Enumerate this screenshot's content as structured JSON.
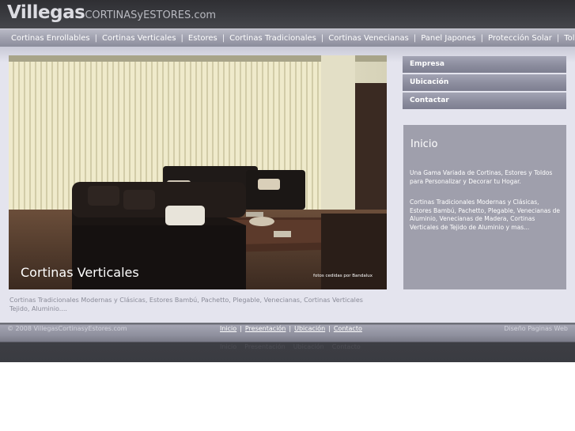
{
  "logo": {
    "main": "Villegas",
    "sub": "CORTINASyESTORES.com"
  },
  "nav": {
    "items": [
      {
        "label": "Cortinas Enrollables"
      },
      {
        "label": "Cortinas Verticales"
      },
      {
        "label": "Estores"
      },
      {
        "label": "Cortinas Tradicionales"
      },
      {
        "label": "Cortinas Venecianas"
      },
      {
        "label": "Panel Japones"
      },
      {
        "label": "Protección Solar"
      },
      {
        "label": "Toldos"
      }
    ],
    "separator": "|"
  },
  "hero": {
    "caption": "Cortinas Verticales",
    "credit": "fotos cedidas por Bandalux"
  },
  "description": "Cortinas Tradicionales Modernas y Clásicas, Estores Bambú, Pachetto, Plegable, Venecianas, Cortinas Verticales Tejido, Aluminio....",
  "sidebar": {
    "items": [
      {
        "label": "Empresa"
      },
      {
        "label": "Ubicación"
      },
      {
        "label": "Contactar"
      }
    ]
  },
  "info_box": {
    "title": "Inicio",
    "paragraph1": "Una Gama Variada de Cortinas, Estores y Toldos para Personalizar y Decorar tu Hogar.",
    "paragraph2": "Cortinas Tradicionales Modernas y Clásicas, Estores Bambú, Pachetto, Plegable, Venecianas de Aluminio, Venecianas de Madera, Cortinas Verticales de Tejido de Aluminio y mas..."
  },
  "footer": {
    "copyright": "© 2008 VillegasCortinasyEstores.com",
    "links": [
      {
        "label": "Inicio"
      },
      {
        "label": "Presentación"
      },
      {
        "label": "Ubicación"
      },
      {
        "label": "Contacto"
      }
    ],
    "separator": "|",
    "right_text": "Diseño Paginas Web"
  }
}
